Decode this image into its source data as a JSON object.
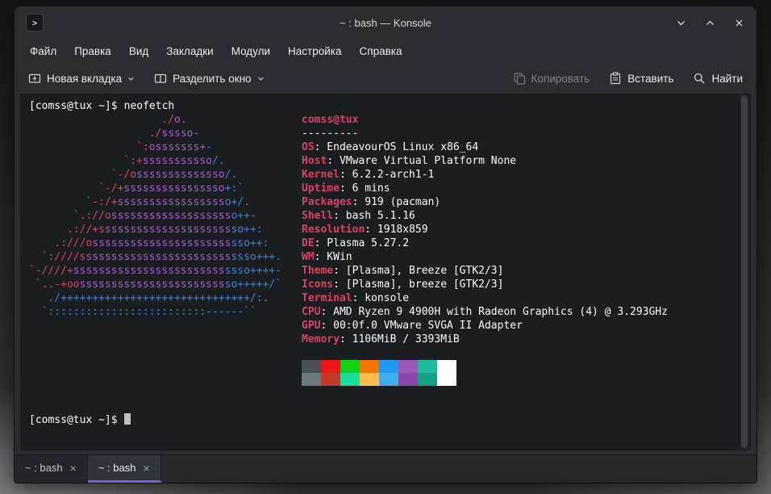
{
  "theme": {
    "accent": "#7c5fd3"
  },
  "window": {
    "title": "~ : bash — Konsole"
  },
  "menu": {
    "items": [
      "Файл",
      "Правка",
      "Вид",
      "Закладки",
      "Модули",
      "Настройка",
      "Справка"
    ]
  },
  "toolbar": {
    "new_tab": "Новая вкладка",
    "split_window": "Разделить окно",
    "copy": "Копировать",
    "paste": "Вставить",
    "find": "Найти"
  },
  "terminal": {
    "prompt": "[comss@tux ~]$",
    "command": "neofetch"
  },
  "neofetch": {
    "colors": {
      "c1": "#dc4069",
      "c2": "#a85fcf",
      "c3": "#3f82d6",
      "text": "#fcfcfc"
    },
    "ascii_lines": [
      [
        {
          "c": "c1",
          "t": "                     ./"
        },
        {
          "c": "c2",
          "t": "o"
        },
        {
          "c": "c3",
          "t": "."
        }
      ],
      [
        {
          "c": "c1",
          "t": "                   ./"
        },
        {
          "c": "c2",
          "t": "sssso"
        },
        {
          "c": "c3",
          "t": "-"
        }
      ],
      [
        {
          "c": "c1",
          "t": "                 `:"
        },
        {
          "c": "c2",
          "t": "osssssss+"
        },
        {
          "c": "c3",
          "t": "-"
        }
      ],
      [
        {
          "c": "c1",
          "t": "               `:+"
        },
        {
          "c": "c2",
          "t": "sssssssssso"
        },
        {
          "c": "c3",
          "t": "/."
        }
      ],
      [
        {
          "c": "c1",
          "t": "             `-/o"
        },
        {
          "c": "c2",
          "t": "ssssssssssssso"
        },
        {
          "c": "c3",
          "t": "/."
        }
      ],
      [
        {
          "c": "c1",
          "t": "           `-/+"
        },
        {
          "c": "c2",
          "t": "ssssssssssssssso"
        },
        {
          "c": "c3",
          "t": "+:`"
        }
      ],
      [
        {
          "c": "c1",
          "t": "         `-:/+"
        },
        {
          "c": "c2",
          "t": "sssssssssssssssss"
        },
        {
          "c": "c3",
          "t": "o+/."
        }
      ],
      [
        {
          "c": "c1",
          "t": "       `.://o"
        },
        {
          "c": "c2",
          "t": "sssssssssssssssssss"
        },
        {
          "c": "c3",
          "t": "o++-"
        }
      ],
      [
        {
          "c": "c1",
          "t": "      .://+s"
        },
        {
          "c": "c2",
          "t": "ssssssssssssssssssss"
        },
        {
          "c": "c3",
          "t": "so++:"
        }
      ],
      [
        {
          "c": "c1",
          "t": "    .:///o"
        },
        {
          "c": "c2",
          "t": "ssssssssssssssssssssss"
        },
        {
          "c": "c3",
          "t": "sso++:"
        }
      ],
      [
        {
          "c": "c1",
          "t": "  `:////s"
        },
        {
          "c": "c2",
          "t": "sssssssssssssssssssssss"
        },
        {
          "c": "c3",
          "t": "ssso+++."
        }
      ],
      [
        {
          "c": "c1",
          "t": "`-////+"
        },
        {
          "c": "c2",
          "t": "ssssssssssssssssssssssss"
        },
        {
          "c": "c3",
          "t": "ssso++++-"
        }
      ],
      [
        {
          "c": "c1",
          "t": " `..-+oo"
        },
        {
          "c": "c2",
          "t": "sssssssssssssssssssssss"
        },
        {
          "c": "c3",
          "t": "so+++++/`"
        }
      ],
      [
        {
          "c": "c3",
          "t": "   ./++++++++++++++++++++++++++++++/:."
        }
      ],
      [
        {
          "c": "c3",
          "t": "  `:::::::::::::::::::::::::------``"
        }
      ]
    ],
    "user_host": "comss@tux",
    "separator": "---------",
    "info": [
      {
        "label": "OS",
        "value": "EndeavourOS Linux x86_64"
      },
      {
        "label": "Host",
        "value": "VMware Virtual Platform None"
      },
      {
        "label": "Kernel",
        "value": "6.2.2-arch1-1"
      },
      {
        "label": "Uptime",
        "value": "6 mins"
      },
      {
        "label": "Packages",
        "value": "919 (pacman)"
      },
      {
        "label": "Shell",
        "value": "bash 5.1.16"
      },
      {
        "label": "Resolution",
        "value": "1918x859"
      },
      {
        "label": "DE",
        "value": "Plasma 5.27.2"
      },
      {
        "label": "WM",
        "value": "KWin"
      },
      {
        "label": "Theme",
        "value": "[Plasma], Breeze [GTK2/3]"
      },
      {
        "label": "Icons",
        "value": "[Plasma], breeze [GTK2/3]"
      },
      {
        "label": "Terminal",
        "value": "konsole"
      },
      {
        "label": "CPU",
        "value": "AMD Ryzen 9 4900H with Radeon Graphics (4) @ 3.293GHz"
      },
      {
        "label": "GPU",
        "value": "00:0f.0 VMware SVGA II Adapter"
      },
      {
        "label": "Memory",
        "value": "1106MiB / 3393MiB"
      }
    ],
    "palette_rows": [
      [
        "#4a5157",
        "#ed1515",
        "#11d116",
        "#f67400",
        "#1d99f3",
        "#9b59b6",
        "#1abc9c",
        "#fcfcfc"
      ],
      [
        "#6e7a7e",
        "#c0392b",
        "#1cdc9a",
        "#fdbc4b",
        "#3daee9",
        "#8e44ad",
        "#16a085",
        "#ffffff"
      ]
    ]
  },
  "tabs": [
    {
      "label": "~ : bash",
      "active": false
    },
    {
      "label": "~ : bash",
      "active": true
    }
  ]
}
